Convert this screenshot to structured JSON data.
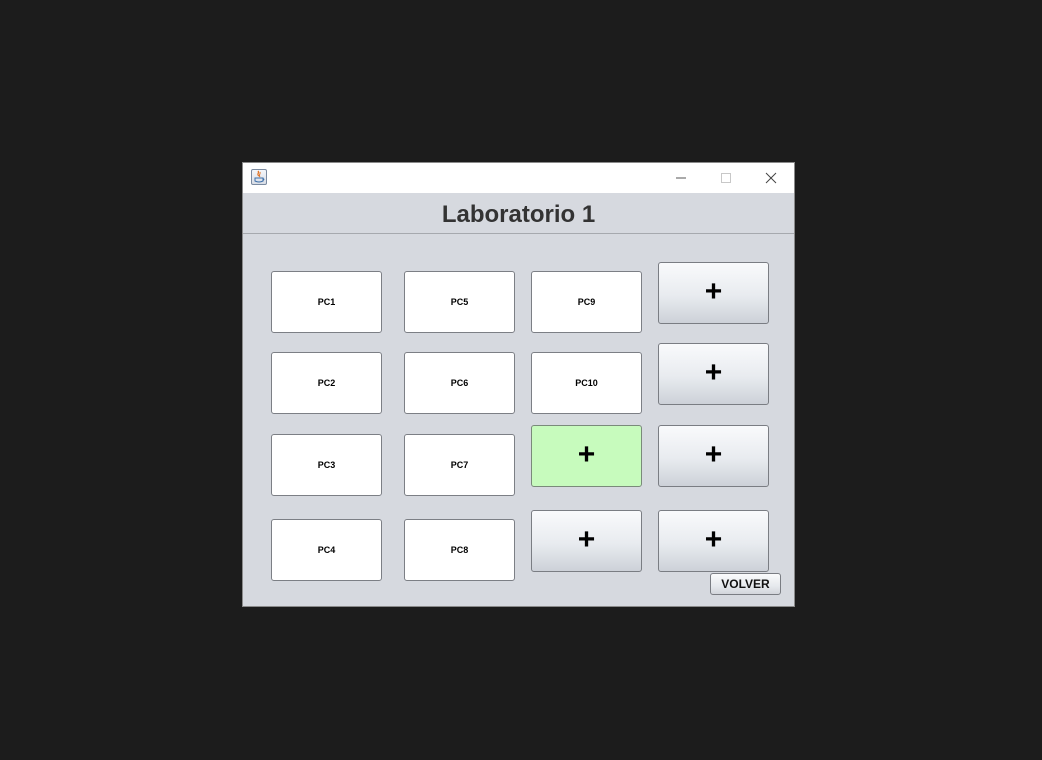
{
  "window": {
    "controls": {
      "minimize_icon": "minimize-icon",
      "maximize_icon": "maximize-icon",
      "close_icon": "close-icon"
    },
    "app_icon": "java-icon"
  },
  "header": {
    "title": "Laboratorio 1"
  },
  "grid": {
    "pcs": [
      {
        "label": "PC1"
      },
      {
        "label": "PC2"
      },
      {
        "label": "PC3"
      },
      {
        "label": "PC4"
      },
      {
        "label": "PC5"
      },
      {
        "label": "PC6"
      },
      {
        "label": "PC7"
      },
      {
        "label": "PC8"
      },
      {
        "label": "PC9"
      },
      {
        "label": "PC10"
      }
    ],
    "add_label": "+",
    "add_highlight_color": "#c7fbbd"
  },
  "footer": {
    "volver_label": "VOLVER"
  },
  "colors": {
    "background": "#1c1c1c",
    "window_bg": "#d6d9df",
    "title_text": "#333333"
  }
}
